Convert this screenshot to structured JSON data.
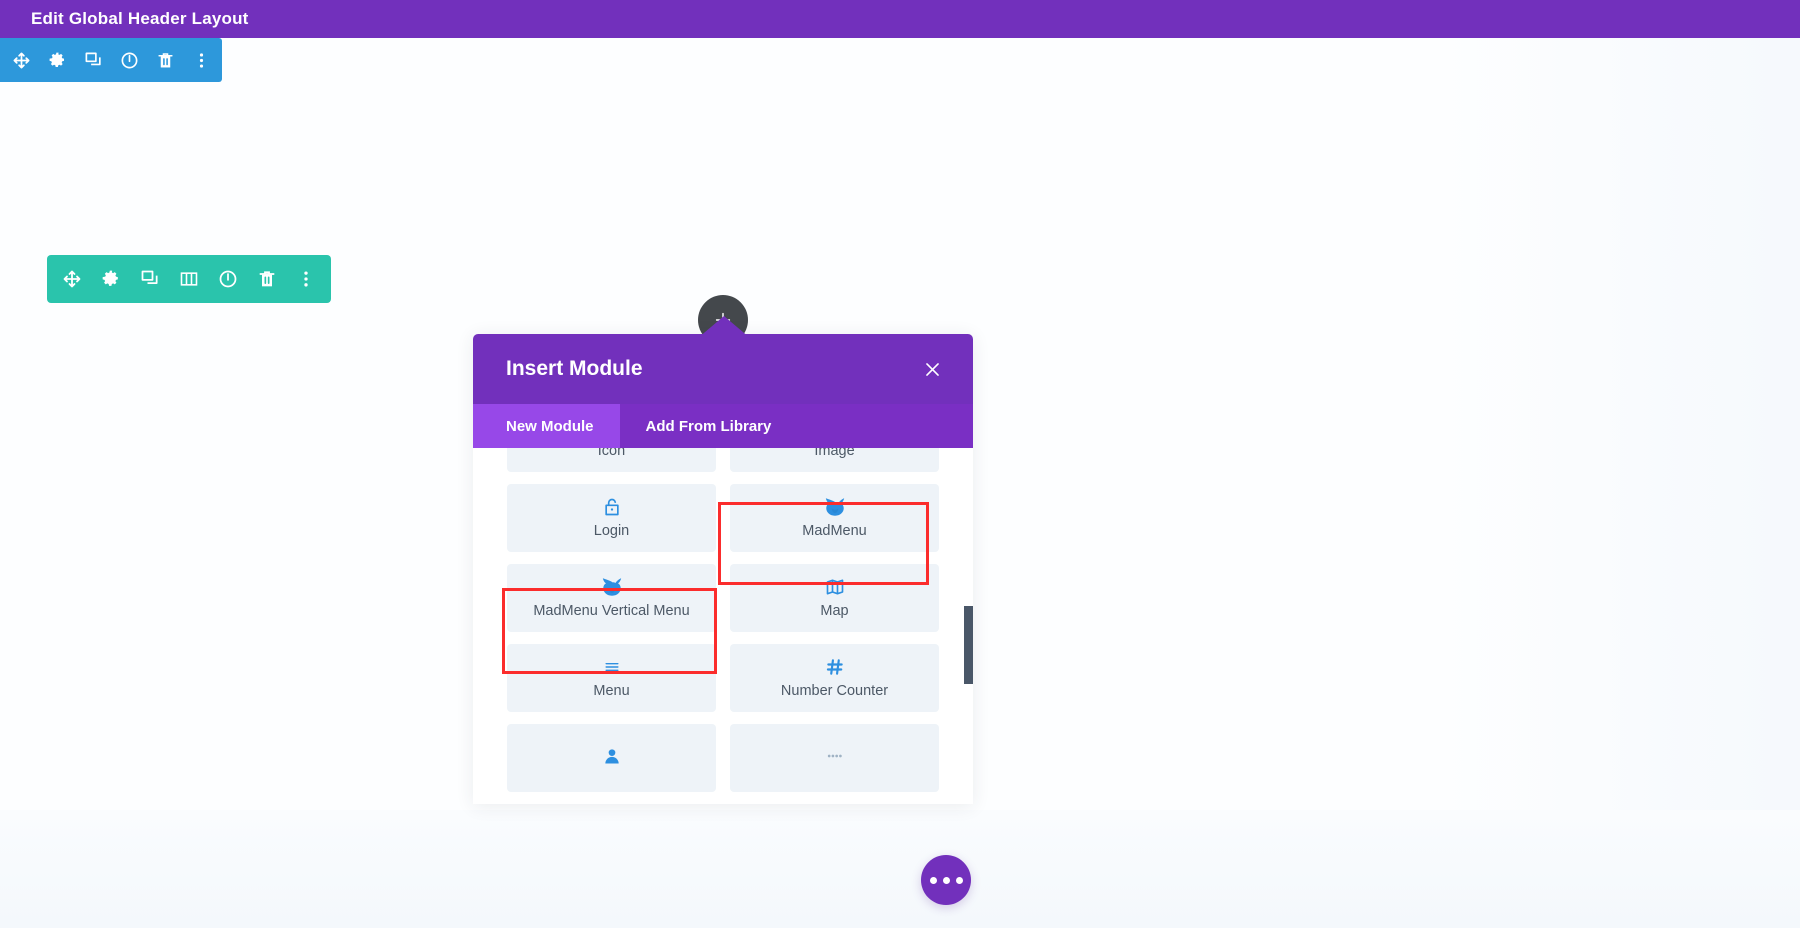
{
  "topbar": {
    "title": "Edit Global Header Layout",
    "background": "#7230bc"
  },
  "section_toolbar": {
    "name": "section-settings-toolbar",
    "color": "#2d98db",
    "icons": [
      {
        "name": "move-icon",
        "label": "Move"
      },
      {
        "name": "gear-icon",
        "label": "Settings"
      },
      {
        "name": "duplicate-icon",
        "label": "Duplicate"
      },
      {
        "name": "power-icon",
        "label": "Disable"
      },
      {
        "name": "trash-icon",
        "label": "Delete"
      },
      {
        "name": "more-vertical-icon",
        "label": "Other Options"
      }
    ]
  },
  "row_toolbar": {
    "name": "row-settings-toolbar",
    "color": "#2ac4ac",
    "icons": [
      {
        "name": "move-icon",
        "label": "Move"
      },
      {
        "name": "gear-icon",
        "label": "Settings"
      },
      {
        "name": "duplicate-icon",
        "label": "Duplicate"
      },
      {
        "name": "columns-icon",
        "label": "Change Column Structure"
      },
      {
        "name": "power-icon",
        "label": "Disable"
      },
      {
        "name": "trash-icon",
        "label": "Delete"
      },
      {
        "name": "more-vertical-icon",
        "label": "Other Options"
      }
    ]
  },
  "add_module_button": {
    "name": "add-module-circle",
    "icon": "plus-icon",
    "color": "#44484c"
  },
  "modal": {
    "title": "Insert Module",
    "close_icon": "close-icon",
    "header_color": "#7230bc",
    "tabs": [
      {
        "label": "New Module",
        "active": true
      },
      {
        "label": "Add From Library",
        "active": false
      }
    ],
    "modules": [
      {
        "label": "Icon",
        "icon": "icon-module-icon",
        "highlighted": false,
        "clipped": true
      },
      {
        "label": "Image",
        "icon": "image-icon",
        "highlighted": false,
        "clipped": true
      },
      {
        "label": "Login",
        "icon": "lock-icon",
        "highlighted": false,
        "clipped": false
      },
      {
        "label": "MadMenu",
        "icon": "madmenu-icon",
        "highlighted": true,
        "clipped": false
      },
      {
        "label": "MadMenu Vertical Menu",
        "icon": "madmenu-icon",
        "highlighted": true,
        "clipped": false
      },
      {
        "label": "Map",
        "icon": "map-icon",
        "highlighted": false,
        "clipped": false
      },
      {
        "label": "Menu",
        "icon": "hamburger-menu-icon",
        "highlighted": false,
        "clipped": false
      },
      {
        "label": "Number Counter",
        "icon": "hash-icon",
        "highlighted": false,
        "clipped": false
      },
      {
        "label": "",
        "icon": "person-icon",
        "highlighted": false,
        "clipped": true
      },
      {
        "label": "",
        "icon": "dots-icon",
        "highlighted": false,
        "clipped": true
      }
    ],
    "highlight_color": "#fb2c2c",
    "card_background": "#eef3f8",
    "icon_color": "#2d8fe0",
    "scrollbar_color": "#4a5768"
  },
  "fab": {
    "name": "editor-options-fab",
    "icon": "more-horizontal-icon",
    "color": "#7230bc"
  }
}
